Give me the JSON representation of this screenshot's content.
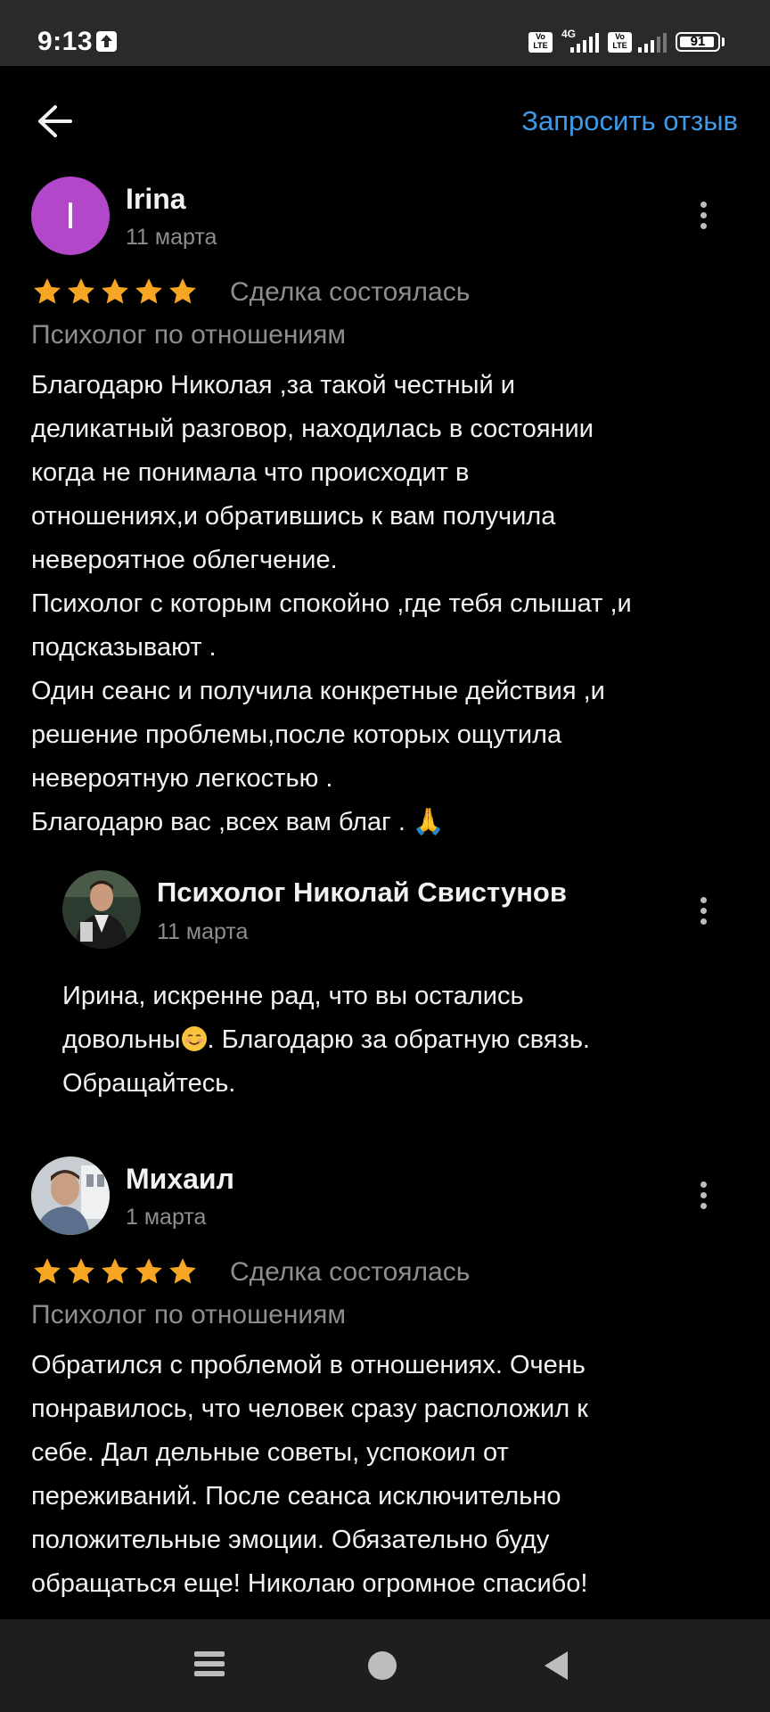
{
  "status_bar": {
    "time": "9:13",
    "network": "4G",
    "volte_label": "Vo\nLTE",
    "battery": "91"
  },
  "header": {
    "back_icon": "arrow-left-icon",
    "request_review": "Запросить отзыв"
  },
  "reviews": [
    {
      "author": "Irina",
      "avatar_letter": "I",
      "avatar_color": "#b347c9",
      "date": "11 марта",
      "rating": 5,
      "deal_status": "Сделка состоялась",
      "service": "Психолог по отношениям",
      "text": "Благодарю Николая ,за такой честный и\nделикатный разговор, находилась в состоянии\nкогда не понимала что происходит в\nотношениях,и обратившись к вам получила\nневероятное облегчение.\nПсихолог с которым спокойно ,где тебя слышат ,и\nподсказывают .\nОдин сеанс и получила конкретные действия ,и\nрешение проблемы,после которых ощутила\nневероятную легкостью .\nБлагодарю вас ,всех вам благ . 🙏",
      "reply": {
        "author": "Психолог Николай Свистунов",
        "date": "11 марта",
        "text_part1": "Ирина,  искренне рад, что вы остались\nдовольны",
        "text_part2": ". Благодарю за обратную связь.\nОбращайтесь."
      }
    },
    {
      "author": "Михаил",
      "date": "1 марта",
      "rating": 5,
      "deal_status": "Сделка состоялась",
      "service": "Психолог по отношениям",
      "text": "Обратился с проблемой в отношениях. Очень\nпонравилось, что человек сразу расположил к\nсебе. Дал дельные советы, успокоил от\nпереживаний. После сеанса исключительно\nположительные эмоции. Обязательно буду\nобращаться еще! Николаю огромное спасибо!"
    }
  ],
  "colors": {
    "accent": "#3d9be9",
    "star": "#f6a623",
    "muted_text": "#8e8e8e",
    "background": "#000000"
  }
}
